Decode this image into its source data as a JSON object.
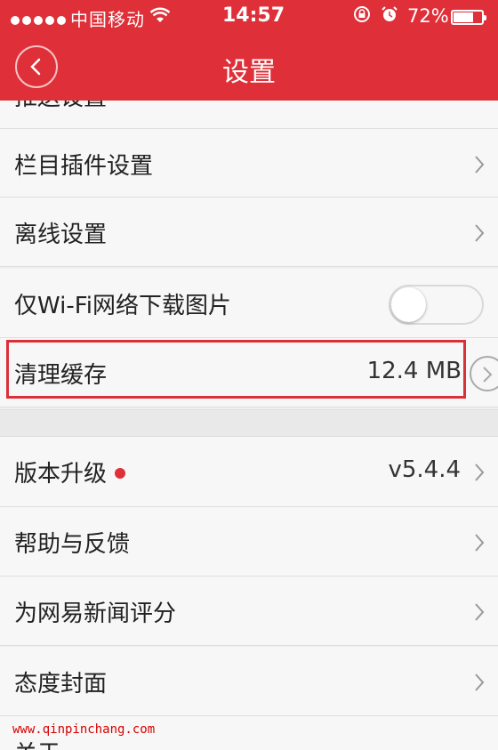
{
  "status_bar": {
    "carrier": "中国移动",
    "time": "14:57",
    "battery": "72%",
    "battery_level": 0.72
  },
  "header": {
    "title": "设置",
    "back_icon": "chevron-left-icon"
  },
  "settings": {
    "partial_item": "推送设置",
    "items": [
      {
        "label": "栏目插件设置"
      },
      {
        "label": "离线设置"
      },
      {
        "label": "仅Wi-Fi网络下载图片",
        "toggle_on": false
      },
      {
        "label": "清理缓存",
        "value": "12.4 MB"
      }
    ],
    "items2": [
      {
        "label": "版本升级",
        "value": "v5.4.4",
        "badge": true
      },
      {
        "label": "帮助与反馈"
      },
      {
        "label": "为网易新闻评分"
      },
      {
        "label": "态度封面"
      }
    ],
    "partial_bottom": "关于"
  },
  "colors": {
    "header_red": "#df2f38",
    "highlight": "#d9303a"
  },
  "watermark": "www.qinpinchang.com"
}
